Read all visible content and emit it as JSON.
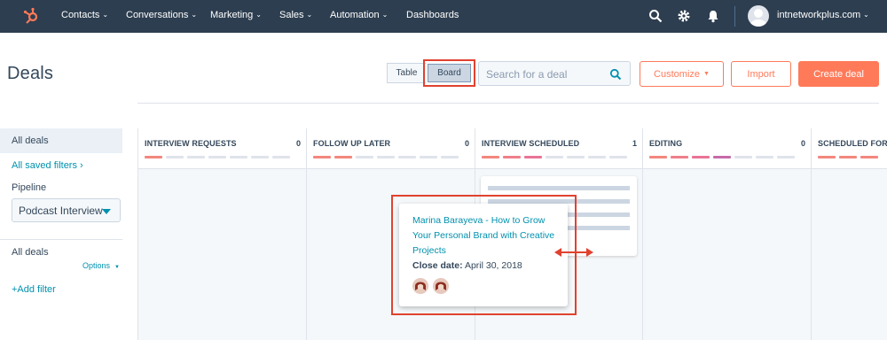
{
  "nav": {
    "items": [
      {
        "label": "Contacts"
      },
      {
        "label": "Conversations"
      },
      {
        "label": "Marketing"
      },
      {
        "label": "Sales"
      },
      {
        "label": "Automation"
      },
      {
        "label": "Dashboards"
      }
    ],
    "account": "intnetworkplus.com",
    "icons": [
      "hubspot-logo",
      "search-icon",
      "gear-icon",
      "bell-icon",
      "avatar"
    ]
  },
  "header": {
    "title": "Deals",
    "view_table": "Table",
    "view_board": "Board",
    "search_placeholder": "Search for a deal",
    "customize": "Customize",
    "import": "Import",
    "create": "Create deal"
  },
  "sidebar": {
    "all_deals": "All deals",
    "saved_filters": "All saved filters",
    "pipeline_label": "Pipeline",
    "pipeline_value": "Podcast Interview",
    "section_title": "All deals",
    "options": "Options",
    "add_filter": "+Add filter"
  },
  "board": {
    "columns": [
      {
        "title": "INTERVIEW REQUESTS",
        "count": "0"
      },
      {
        "title": "FOLLOW UP LATER",
        "count": "0"
      },
      {
        "title": "INTERVIEW SCHEDULED",
        "count": "1"
      },
      {
        "title": "EDITING",
        "count": "0"
      },
      {
        "title": "SCHEDULED FOR A",
        "count": ""
      }
    ]
  },
  "card": {
    "deal_name": "Marina Barayeva - How to Grow Your Personal Brand with Creative Projects",
    "close_label": "Close date:",
    "close_date": "April 30, 2018"
  },
  "colors": {
    "nav_bg": "#2d3e50",
    "accent": "#ff7a59",
    "link": "#0091ae",
    "annotation": "#e0422f"
  }
}
